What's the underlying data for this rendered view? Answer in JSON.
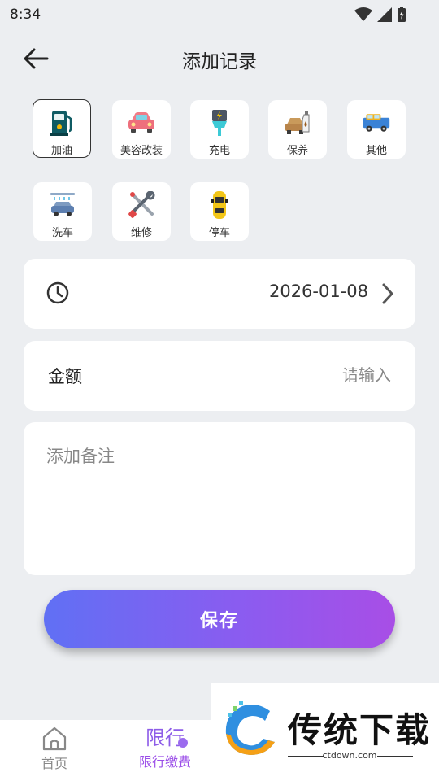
{
  "status_bar": {
    "time": "8:34"
  },
  "header": {
    "title": "添加记录"
  },
  "categories": [
    {
      "label": "加油",
      "icon": "fuel-pump-icon",
      "selected": true
    },
    {
      "label": "美容改装",
      "icon": "car-beauty-icon",
      "selected": false
    },
    {
      "label": "充电",
      "icon": "charging-plug-icon",
      "selected": false
    },
    {
      "label": "保养",
      "icon": "oil-maintenance-icon",
      "selected": false
    },
    {
      "label": "其他",
      "icon": "truck-icon",
      "selected": false
    },
    {
      "label": "洗车",
      "icon": "car-wash-icon",
      "selected": false
    },
    {
      "label": "维修",
      "icon": "repair-tools-icon",
      "selected": false
    },
    {
      "label": "停车",
      "icon": "parking-car-icon",
      "selected": false
    }
  ],
  "date": {
    "value": "2026-01-08"
  },
  "amount": {
    "label": "金额",
    "placeholder": "请输入",
    "value": ""
  },
  "note": {
    "placeholder": "添加备注",
    "value": ""
  },
  "save": {
    "label": "保存"
  },
  "tabbar": {
    "home_label": "首页",
    "limit_label": "限行缴费",
    "limit_glyph": "限行"
  },
  "watermark": {
    "title": "传统下载",
    "url": "ctdown.com"
  },
  "colors": {
    "accent_start": "#6070f4",
    "accent_end": "#a84ee6",
    "active_tab": "#9b4ee8",
    "background": "#eceef1"
  }
}
